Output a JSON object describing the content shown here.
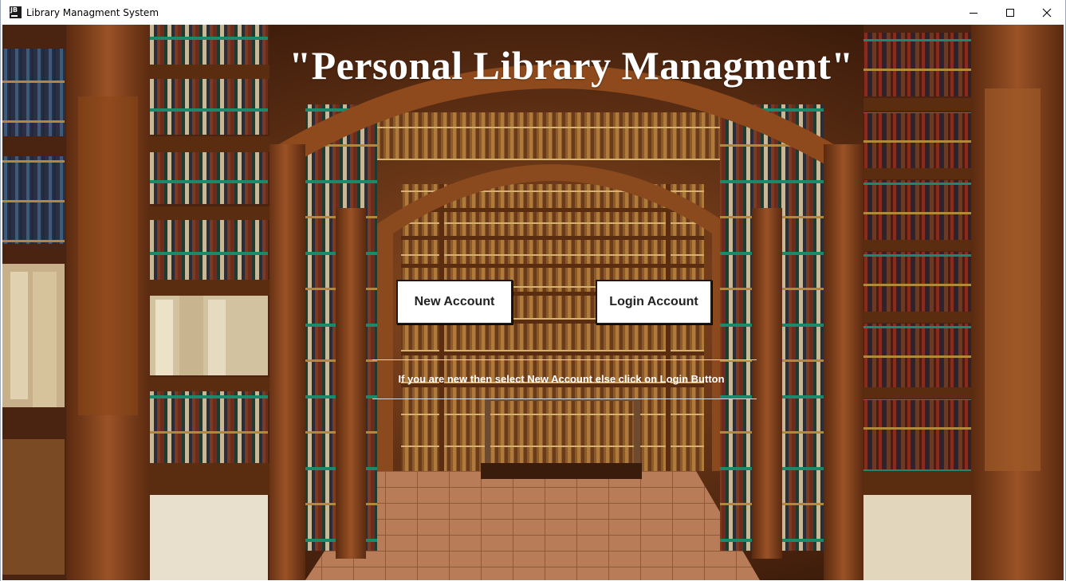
{
  "window": {
    "title": "Library Managment System",
    "icon": "java-app-icon",
    "controls": [
      "minimize-icon",
      "maximize-icon",
      "close-icon"
    ]
  },
  "main": {
    "heading": "\"Personal Library Managment\"",
    "new_account_label": "New Account",
    "login_account_label": "Login Account",
    "hint": "If you are new then select New Account  else click on Login Button"
  },
  "colors": {
    "heading_text": "#ffffff",
    "button_bg": "#ffffff",
    "button_border": "#1a1a1a",
    "wood": "#7a3a14",
    "floor": "#b77a55"
  },
  "background_image": "library-hall-with-arched-bookshelves"
}
